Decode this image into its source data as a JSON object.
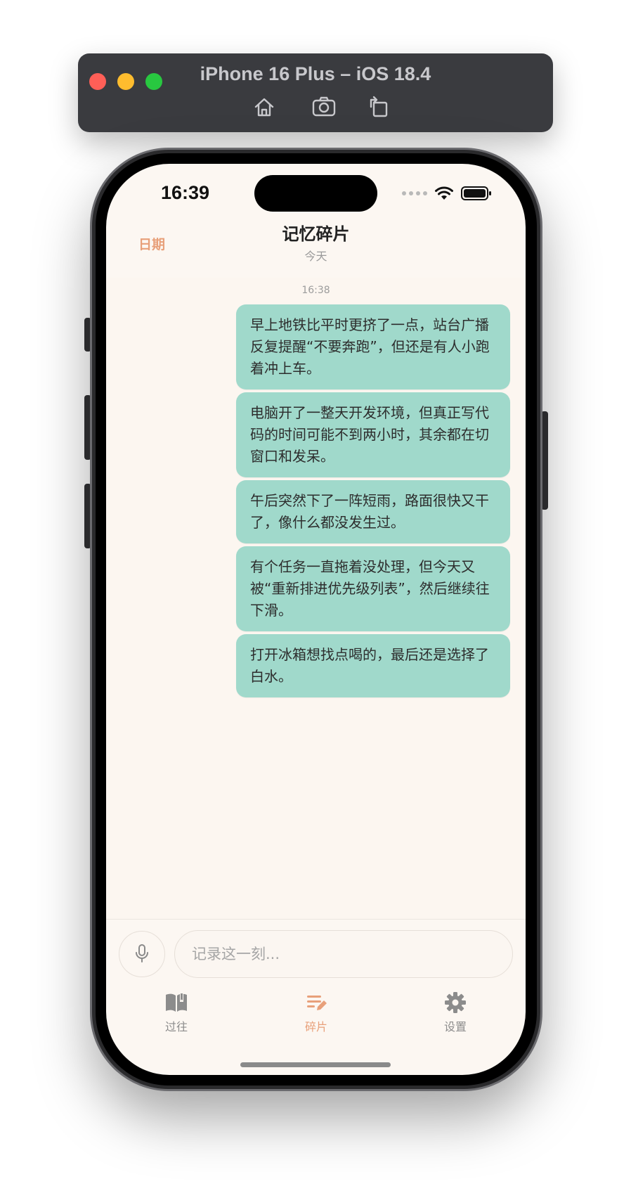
{
  "simulator": {
    "title": "iPhone 16 Plus – iOS 18.4",
    "tools": [
      "home-icon",
      "screenshot-icon",
      "rotate-icon"
    ]
  },
  "status_bar": {
    "time": "16:39"
  },
  "nav": {
    "left_button": "日期",
    "title": "记忆碎片",
    "subtitle": "今天"
  },
  "chat": {
    "timestamp": "16:38",
    "messages": [
      "早上地铁比平时更挤了一点，站台广播反复提醒“不要奔跑”，但还是有人小跑着冲上车。",
      "电脑开了一整天开发环境，但真正写代码的时间可能不到两小时，其余都在切窗口和发呆。",
      "午后突然下了一阵短雨，路面很快又干了，像什么都没发生过。",
      "有个任务一直拖着没处理，但今天又被“重新排进优先级列表”，然后继续往下滑。",
      "打开冰箱想找点喝的，最后还是选择了白水。"
    ]
  },
  "input": {
    "placeholder": "记录这一刻...",
    "value": ""
  },
  "tabs": [
    {
      "label": "过往",
      "icon": "book-icon",
      "active": false
    },
    {
      "label": "碎片",
      "icon": "edit-list-icon",
      "active": true
    },
    {
      "label": "设置",
      "icon": "gear-icon",
      "active": false
    }
  ],
  "colors": {
    "accent": "#e8a07a",
    "bubble": "#a0d9cb",
    "background": "#fcf7f2"
  }
}
